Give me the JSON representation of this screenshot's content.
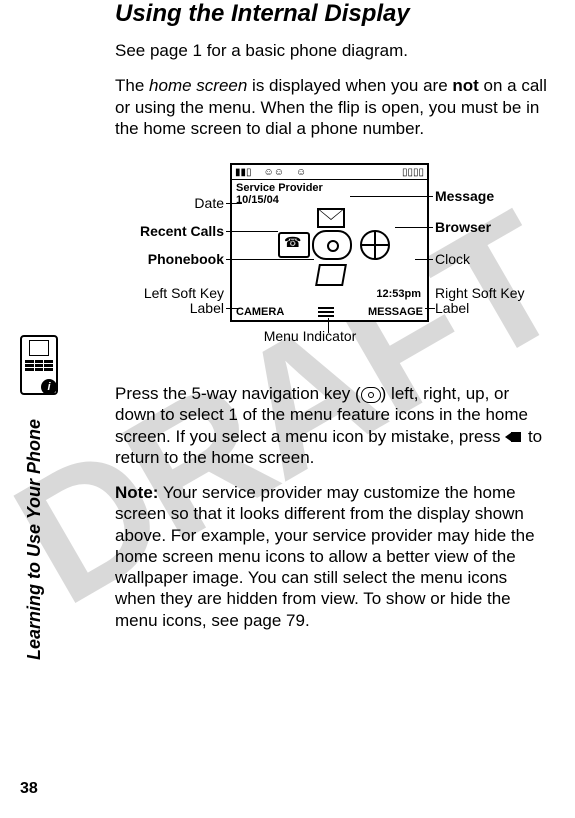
{
  "watermark": "DRAFT",
  "heading": "Using the Internal Display",
  "intro1": "See page 1 for a basic phone diagram.",
  "intro2a": "The ",
  "intro2_home": "home screen",
  "intro2b": " is displayed when you are ",
  "intro2_not": "not",
  "intro2c": " on a call or using the menu. When the flip is open, you must be in the home screen to dial a phone number.",
  "screen": {
    "provider": "Service Provider",
    "date": "10/15/04",
    "clock": "12:53pm",
    "left_soft": "CAMERA",
    "right_soft": "MESSAGE"
  },
  "callouts": {
    "date": "Date",
    "recent": "Recent Calls",
    "phonebook": "Phonebook",
    "left_soft": "Left Soft Key Label",
    "menu": "Menu Indicator",
    "message": "Message",
    "browser": "Browser",
    "clock": "Clock",
    "right_soft": "Right Soft Key Label"
  },
  "body_nav_a": "Press the 5-way navigation key (",
  "body_nav_b": ") left, right, up, or down to select 1 of the menu feature icons in the home screen. If you select a menu icon by mistake, press ",
  "body_nav_c": " to return to the home screen.",
  "note_label": "Note:",
  "note_body": " Your service provider may customize the home screen so that it looks different from the display shown above. For example, your service provider may hide the home screen menu icons to allow a better view of the wallpaper image. You can still select the menu icons when they are hidden from view. To show or hide the menu icons, see page 79.",
  "side_tab": "Learning to Use Your Phone",
  "page_number": "38"
}
